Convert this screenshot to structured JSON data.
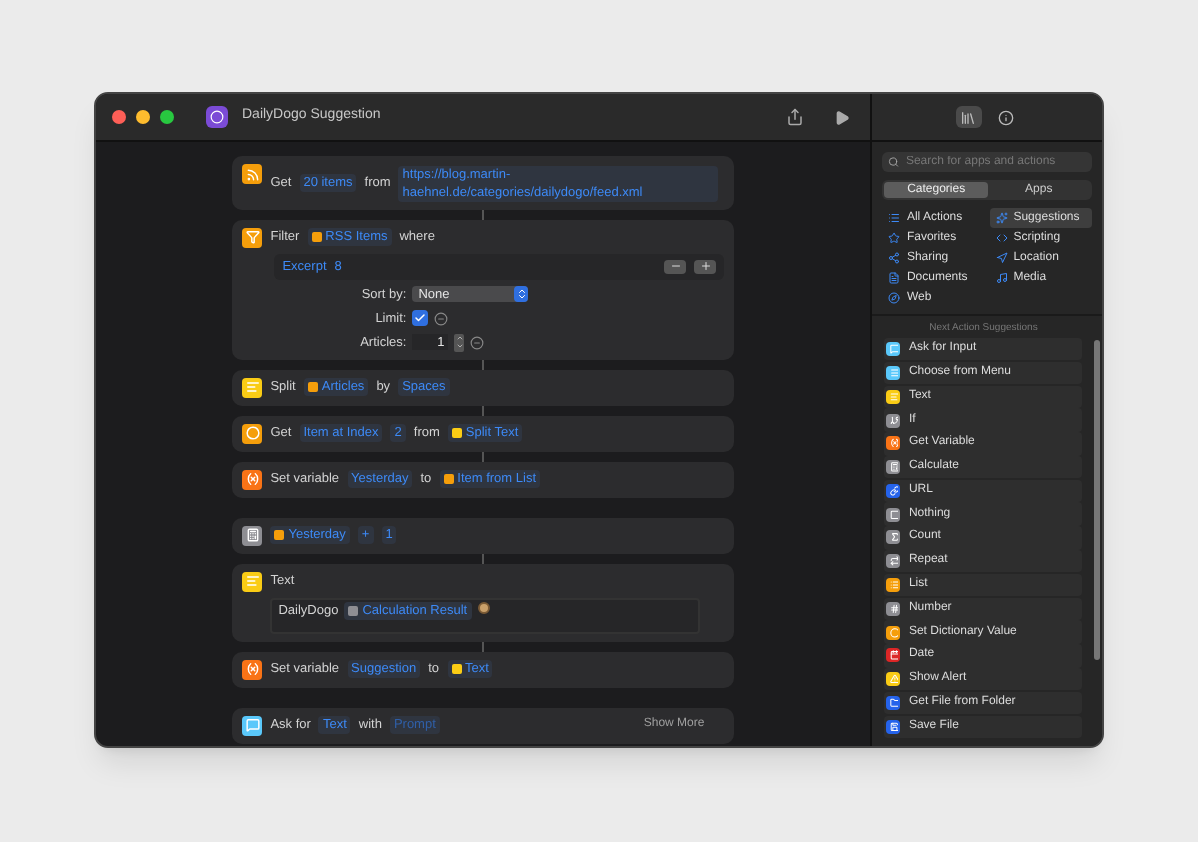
{
  "window": {
    "title": "DailyDogo Suggestion"
  },
  "groups": [
    {
      "actions": [
        {
          "kind": "rss",
          "color": "#f59e0b",
          "tokens": [
            {
              "kind": "text",
              "text": "Get"
            },
            {
              "kind": "param",
              "text": "20 items"
            },
            {
              "kind": "text",
              "text": "from"
            },
            {
              "kind": "url",
              "text": "https://blog.martin-haehnel.de/categories/dailydogo/feed.xml"
            }
          ]
        },
        {
          "kind": "filter",
          "color": "#f59e0b",
          "tokens": [
            {
              "kind": "text",
              "text": "Filter"
            },
            {
              "kind": "var",
              "text": "RSS Items",
              "color": "#f59e0b"
            },
            {
              "kind": "text",
              "text": "where"
            }
          ],
          "filter": {
            "rules": [
              {
                "field": "Excerpt",
                "value": "8"
              }
            ],
            "sort_label": "Sort by:",
            "sort_value": "None",
            "limit_label": "Limit:",
            "limit_checked": true,
            "count_label": "Articles:",
            "count_value": "1"
          }
        },
        {
          "kind": "lines",
          "color": "#facc15",
          "tokens": [
            {
              "kind": "text",
              "text": "Split"
            },
            {
              "kind": "var",
              "text": "Articles",
              "color": "#f59e0b"
            },
            {
              "kind": "text",
              "text": "by"
            },
            {
              "kind": "param",
              "text": "Spaces"
            }
          ]
        },
        {
          "kind": "ring",
          "color": "#f59e0b",
          "tokens": [
            {
              "kind": "text",
              "text": "Get"
            },
            {
              "kind": "param",
              "text": "Item at Index"
            },
            {
              "kind": "param",
              "text": "2"
            },
            {
              "kind": "text",
              "text": "from"
            },
            {
              "kind": "var",
              "text": "Split Text",
              "color": "#facc15"
            }
          ]
        },
        {
          "kind": "variable",
          "color": "#f97316",
          "tokens": [
            {
              "kind": "text",
              "text": "Set variable"
            },
            {
              "kind": "param",
              "text": "Yesterday"
            },
            {
              "kind": "text",
              "text": "to"
            },
            {
              "kind": "var",
              "text": "Item from List",
              "color": "#f59e0b"
            }
          ]
        }
      ]
    },
    {
      "actions": [
        {
          "kind": "calculator",
          "color": "#8e8e93",
          "tokens": [
            {
              "kind": "var",
              "text": "Yesterday",
              "color": "#f59e0b"
            },
            {
              "kind": "param",
              "text": "+"
            },
            {
              "kind": "param",
              "text": "1"
            }
          ]
        },
        {
          "kind": "lines",
          "color": "#facc15",
          "tokens": [
            {
              "kind": "text",
              "text": "Text"
            }
          ],
          "body": [
            {
              "kind": "text",
              "text": "DailyDogo"
            },
            {
              "kind": "var",
              "text": "Calculation Result",
              "color": "#8e8e93"
            },
            {
              "kind": "emoji"
            }
          ]
        },
        {
          "kind": "variable",
          "color": "#f97316",
          "tokens": [
            {
              "kind": "text",
              "text": "Set variable"
            },
            {
              "kind": "param",
              "text": "Suggestion"
            },
            {
              "kind": "text",
              "text": "to"
            },
            {
              "kind": "var",
              "text": "Text",
              "color": "#facc15"
            }
          ]
        }
      ]
    },
    {
      "actions": [
        {
          "kind": "message",
          "color": "#5ac8fa",
          "tokens": [
            {
              "kind": "text",
              "text": "Ask for"
            },
            {
              "kind": "param",
              "text": "Text"
            },
            {
              "kind": "text",
              "text": "with"
            },
            {
              "kind": "placeholder",
              "text": "Prompt"
            }
          ],
          "show_more": "Show More"
        }
      ]
    }
  ],
  "sidebar": {
    "tabs": [
      {
        "kind": "library",
        "selected": true
      },
      {
        "kind": "info",
        "selected": false
      }
    ],
    "search": {
      "placeholder": "Search for apps and actions"
    },
    "segments": [
      {
        "label": "Categories",
        "selected": true
      },
      {
        "label": "Apps",
        "selected": false
      }
    ],
    "categories": [
      {
        "label": "All Actions",
        "kind": "list",
        "selected": false
      },
      {
        "label": "Suggestions",
        "kind": "sparkles",
        "selected": true
      },
      {
        "label": "Favorites",
        "kind": "star",
        "selected": false
      },
      {
        "label": "Scripting",
        "kind": "scripting",
        "selected": false
      },
      {
        "label": "Sharing",
        "kind": "share",
        "selected": false
      },
      {
        "label": "Location",
        "kind": "location",
        "selected": false
      },
      {
        "label": "Documents",
        "kind": "document",
        "selected": false
      },
      {
        "label": "Media",
        "kind": "music",
        "selected": false
      },
      {
        "label": "Web",
        "kind": "compass",
        "selected": false
      }
    ],
    "suggestions_heading": "Next Action Suggestions",
    "suggestions": [
      {
        "label": "Ask for Input",
        "kind": "message",
        "color": "#5ac8fa"
      },
      {
        "label": "Choose from Menu",
        "kind": "menu",
        "color": "#5ac8fa"
      },
      {
        "label": "Text",
        "kind": "lines",
        "color": "#facc15"
      },
      {
        "label": "If",
        "kind": "branch",
        "color": "#8e8e93"
      },
      {
        "label": "Get Variable",
        "kind": "variable",
        "color": "#f97316"
      },
      {
        "label": "Calculate",
        "kind": "calculator",
        "color": "#8e8e93"
      },
      {
        "label": "URL",
        "kind": "link",
        "color": "#2563eb"
      },
      {
        "label": "Nothing",
        "kind": "square",
        "color": "#8e8e93"
      },
      {
        "label": "Count",
        "kind": "sigma",
        "color": "#8e8e93"
      },
      {
        "label": "Repeat",
        "kind": "repeat",
        "color": "#8e8e93"
      },
      {
        "label": "List",
        "kind": "list",
        "color": "#f59e0b"
      },
      {
        "label": "Number",
        "kind": "hash",
        "color": "#8e8e93"
      },
      {
        "label": "Set Dictionary Value",
        "kind": "ring",
        "color": "#f59e0b"
      },
      {
        "label": "Date",
        "kind": "calendar",
        "color": "#dc2626"
      },
      {
        "label": "Show Alert",
        "kind": "alert",
        "color": "#facc15"
      },
      {
        "label": "Get File from Folder",
        "kind": "folder",
        "color": "#2563eb"
      },
      {
        "label": "Save File",
        "kind": "save",
        "color": "#2563eb"
      }
    ]
  }
}
